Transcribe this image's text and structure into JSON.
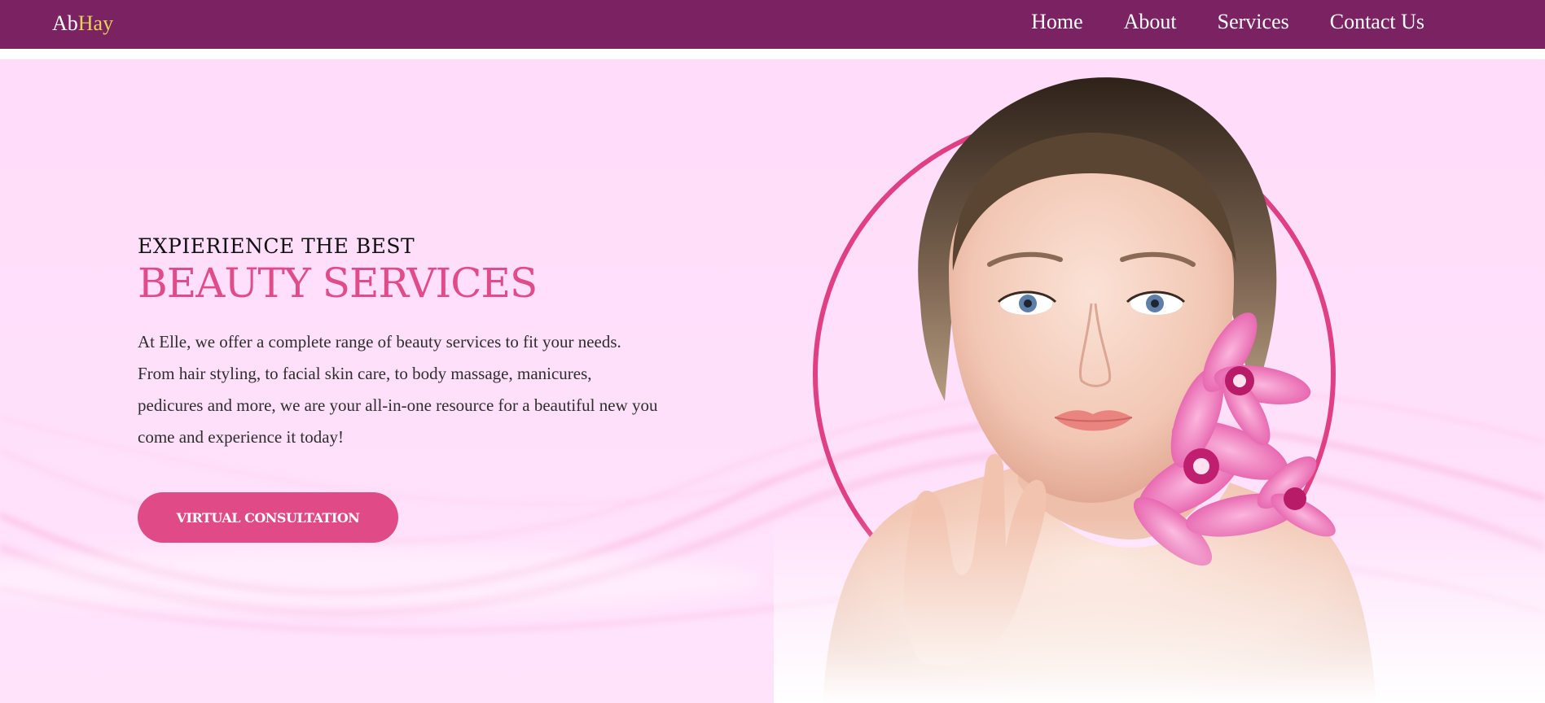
{
  "brand": {
    "logo_part1": "Ab",
    "logo_part2": "Hay"
  },
  "nav": {
    "items": [
      {
        "label": "Home"
      },
      {
        "label": "About"
      },
      {
        "label": "Services"
      },
      {
        "label": "Contact Us"
      }
    ]
  },
  "hero": {
    "eyebrow": "EXPIERIENCE THE BEST",
    "headline": "BEAUTY SERVICES",
    "description": "At Elle, we offer a complete range of beauty services to fit your needs. From hair styling, to facial skin care, to body massage, manicures, pedicures and more, we are your all-in-one resource for a beautiful new you come and experience it today!",
    "cta_label": "VIRTUAL CONSULTATION"
  },
  "colors": {
    "navbar": "#7b2263",
    "logo_accent": "#e7d257",
    "hero_background": "#ffdcfa",
    "headline": "#e04c8a",
    "cta_button": "#e04a86",
    "ring": "#e03f83"
  },
  "icons": [
    "portrait-illustration"
  ]
}
